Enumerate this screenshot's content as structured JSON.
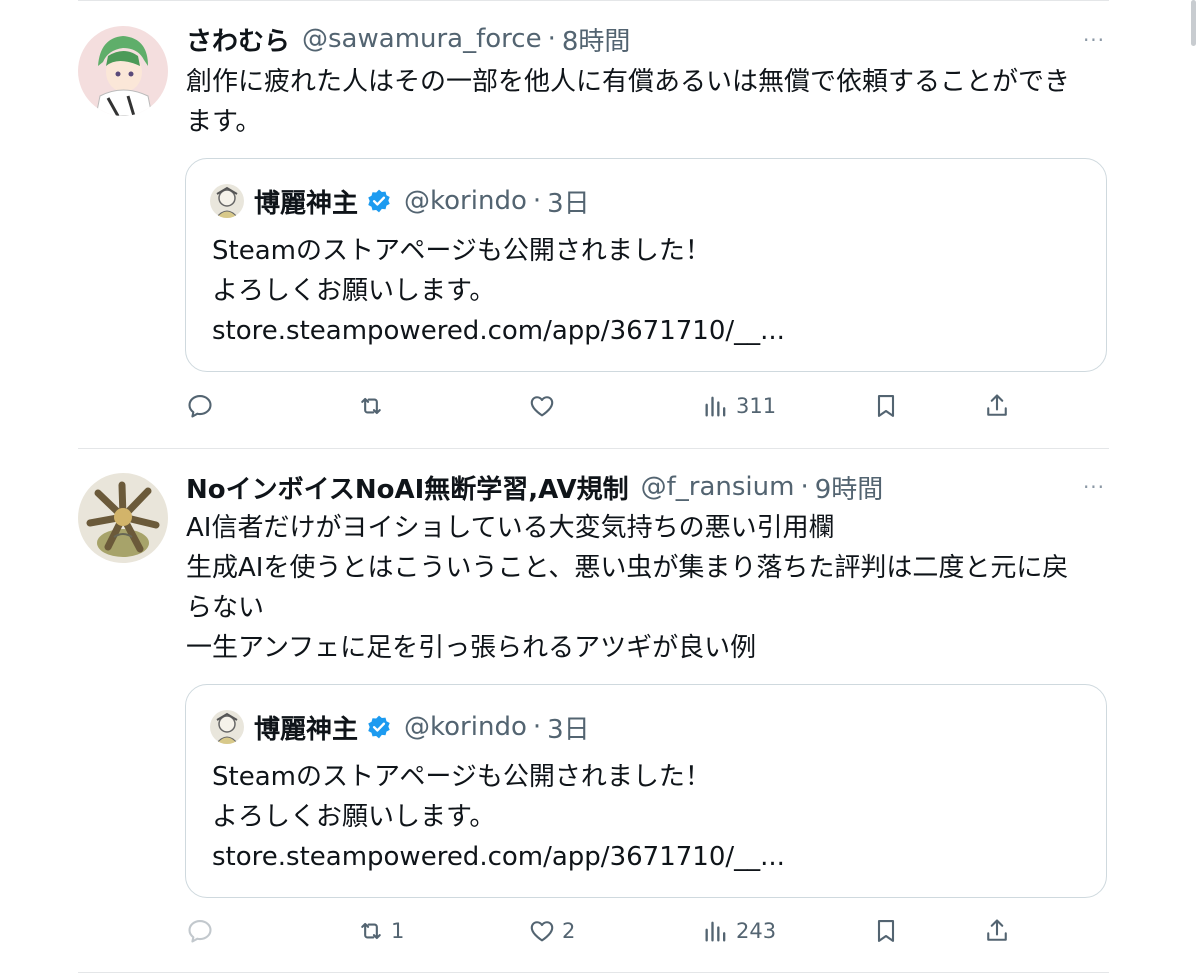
{
  "tweets": [
    {
      "name": "さわむら",
      "handle": "@sawamura_force",
      "time": "8時間",
      "text_lines": [
        "創作に疲れた人はその一部を他人に有償あるいは無償で依頼することができ",
        "ます。"
      ],
      "quote": {
        "name": "博麗神主",
        "handle": "@korindo",
        "time": "3日",
        "text_lines": [
          "Steamのストアページも公開されました！",
          "よろしくお願いします。",
          "store.steampowered.com/app/3671710/__..."
        ]
      },
      "actions": {
        "reply": "",
        "retweet": "",
        "like": "",
        "views": "311"
      }
    },
    {
      "name": "NoインボイスNoAI無断学習,AV規制",
      "handle": "@f_ransium",
      "time": "9時間",
      "text_lines": [
        "AI信者だけがヨイショしている大変気持ちの悪い引用欄",
        "生成AIを使うとはこういうこと、悪い虫が集まり落ちた評判は二度と元に戻",
        "らない",
        "一生アンフェに足を引っ張られるアツギが良い例"
      ],
      "quote": {
        "name": "博麗神主",
        "handle": "@korindo",
        "time": "3日",
        "text_lines": [
          "Steamのストアページも公開されました！",
          "よろしくお願いします。",
          "store.steampowered.com/app/3671710/__..."
        ]
      },
      "actions": {
        "reply": "",
        "retweet": "1",
        "like": "2",
        "views": "243"
      }
    }
  ],
  "separator_dot": "·",
  "more_label": "···",
  "colors": {
    "text": "#0f1419",
    "secondary": "#536471",
    "border": "#cfd9de",
    "verified": "#1d9bf0"
  },
  "icons": [
    "reply-icon",
    "retweet-icon",
    "like-icon",
    "views-icon",
    "bookmark-icon",
    "share-icon",
    "more-icon",
    "verified-badge-icon"
  ]
}
